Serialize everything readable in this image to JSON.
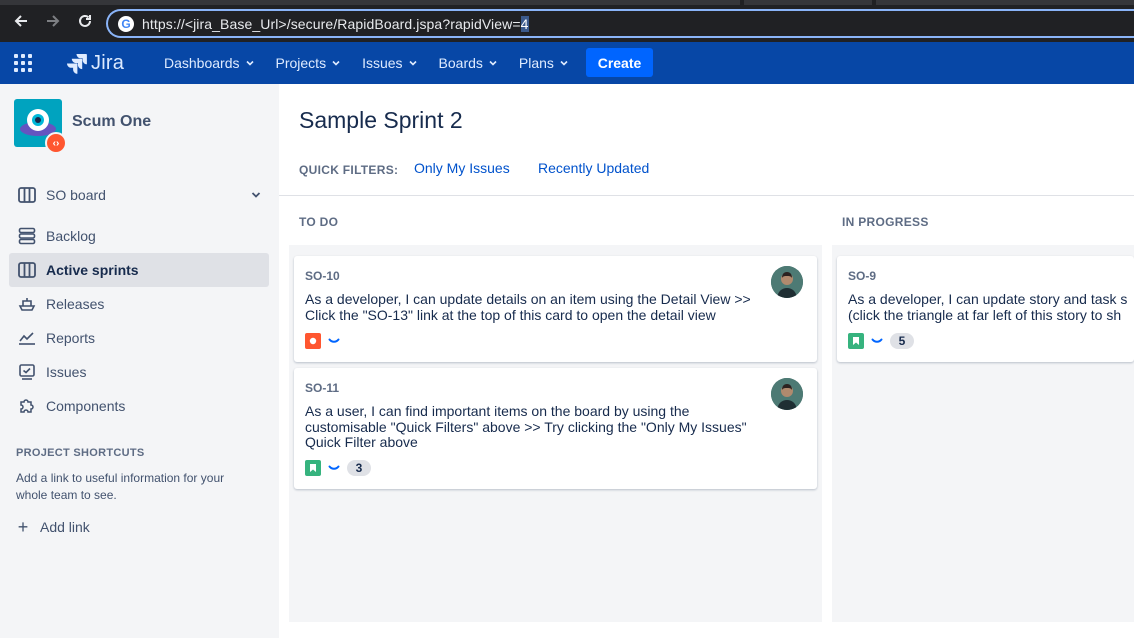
{
  "browser": {
    "url_prefix": "https://<jira_Base_Url>/secure/RapidBoard.jspa?rapidView=",
    "url_selected": "4"
  },
  "topbar": {
    "product": "Jira",
    "nav": [
      {
        "label": "Dashboards"
      },
      {
        "label": "Projects"
      },
      {
        "label": "Issues"
      },
      {
        "label": "Boards"
      },
      {
        "label": "Plans"
      }
    ],
    "create_label": "Create",
    "colors": {
      "bar": "#0747a6",
      "create": "#0065ff"
    }
  },
  "sidebar": {
    "project_name": "Scum One",
    "board_selector": "SO board",
    "items": [
      {
        "label": "Backlog",
        "icon": "backlog-icon"
      },
      {
        "label": "Active sprints",
        "icon": "board-icon",
        "active": true
      },
      {
        "label": "Releases",
        "icon": "ship-icon"
      },
      {
        "label": "Reports",
        "icon": "reports-chart-icon"
      },
      {
        "label": "Issues",
        "icon": "issues-icon"
      },
      {
        "label": "Components",
        "icon": "puzzle-icon"
      }
    ],
    "shortcuts_title": "PROJECT SHORTCUTS",
    "shortcuts_desc": "Add a link to useful information for your whole team to see.",
    "add_link": "Add link"
  },
  "main": {
    "sprint_title": "Sample Sprint 2",
    "quick_filters_label": "QUICK FILTERS:",
    "quick_filters": [
      "Only My Issues",
      "Recently Updated"
    ],
    "columns": [
      {
        "title": "TO DO",
        "cards": [
          {
            "key": "SO-10",
            "summary_lines": [
              "As a developer, I can update details on an item using the Detail View >>",
              "Click the \"SO-13\" link at the top of this card to open the detail view"
            ],
            "type": "bug",
            "type_color": "#ff5630",
            "priority": "low",
            "estimate": ""
          },
          {
            "key": "SO-11",
            "summary_lines": [
              "As a user, I can find important items on the board by using the",
              "customisable \"Quick Filters\" above >> Try clicking the \"Only My Issues\"",
              "Quick Filter above"
            ],
            "type": "story",
            "type_color": "#36b37e",
            "priority": "low",
            "estimate": "3"
          }
        ]
      },
      {
        "title": "IN PROGRESS",
        "cards": [
          {
            "key": "SO-9",
            "summary_lines": [
              "As a developer, I can update story and task s",
              "(click the triangle at far left of this story to sh"
            ],
            "type": "story",
            "type_color": "#36b37e",
            "priority": "low",
            "estimate": "5"
          }
        ]
      }
    ]
  }
}
